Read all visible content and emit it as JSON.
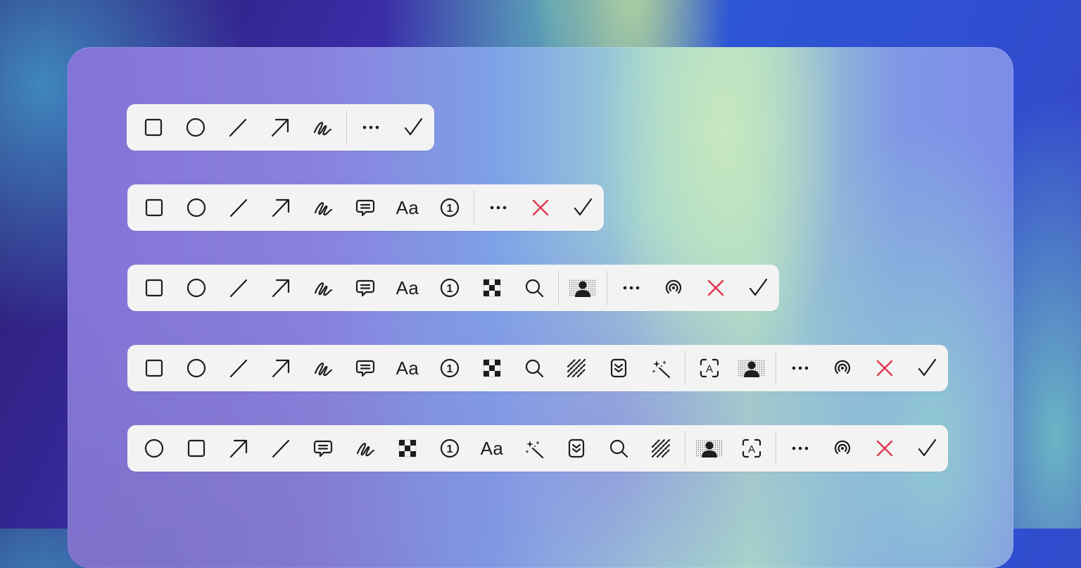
{
  "colors": {
    "toolbar_background": "#f3f3f4",
    "icon": "#1d1d1f",
    "cancel_accent": "#e0364f",
    "separator": "#cfcfd3"
  },
  "toolbars": [
    {
      "name": "toolbar-1",
      "tools": [
        "rectangle-icon",
        "circle-icon",
        "line-icon",
        "arrow-icon",
        "scribble-icon",
        "|",
        "more-icon",
        "checkmark-icon"
      ]
    },
    {
      "name": "toolbar-2",
      "tools": [
        "rectangle-icon",
        "circle-icon",
        "line-icon",
        "arrow-icon",
        "scribble-icon",
        "speech-bubble-icon",
        "text-tool",
        "counter-icon",
        "|",
        "more-icon",
        "cancel-icon",
        "checkmark-icon"
      ]
    },
    {
      "name": "toolbar-3",
      "tools": [
        "rectangle-icon",
        "circle-icon",
        "line-icon",
        "arrow-icon",
        "scribble-icon",
        "speech-bubble-icon",
        "text-tool",
        "counter-icon",
        "pixelate-icon",
        "magnifier-icon",
        "|",
        "remove-background-icon",
        "|",
        "more-icon",
        "airdrop-icon",
        "cancel-icon",
        "checkmark-icon"
      ]
    },
    {
      "name": "toolbar-4",
      "tools": [
        "rectangle-icon",
        "circle-icon",
        "line-icon",
        "arrow-icon",
        "scribble-icon",
        "speech-bubble-icon",
        "text-tool",
        "counter-icon",
        "pixelate-icon",
        "magnifier-icon",
        "blur-icon",
        "scroll-capture-icon",
        "magic-wand-icon",
        "|",
        "text-recognition-icon",
        "remove-background-icon",
        "|",
        "more-icon",
        "airdrop-icon",
        "cancel-icon",
        "checkmark-icon"
      ]
    },
    {
      "name": "toolbar-5",
      "tools": [
        "circle-icon",
        "rectangle-icon",
        "arrow-icon",
        "line-icon",
        "speech-bubble-icon",
        "scribble-icon",
        "pixelate-icon",
        "counter-icon",
        "text-tool",
        "magic-wand-icon",
        "scroll-capture-icon",
        "magnifier-icon",
        "blur-icon",
        "|",
        "remove-background-icon",
        "text-recognition-icon",
        "|",
        "more-icon",
        "airdrop-icon",
        "cancel-icon",
        "checkmark-icon"
      ]
    }
  ],
  "labels": {
    "text_tool": "Aa",
    "counter_number": "1"
  }
}
